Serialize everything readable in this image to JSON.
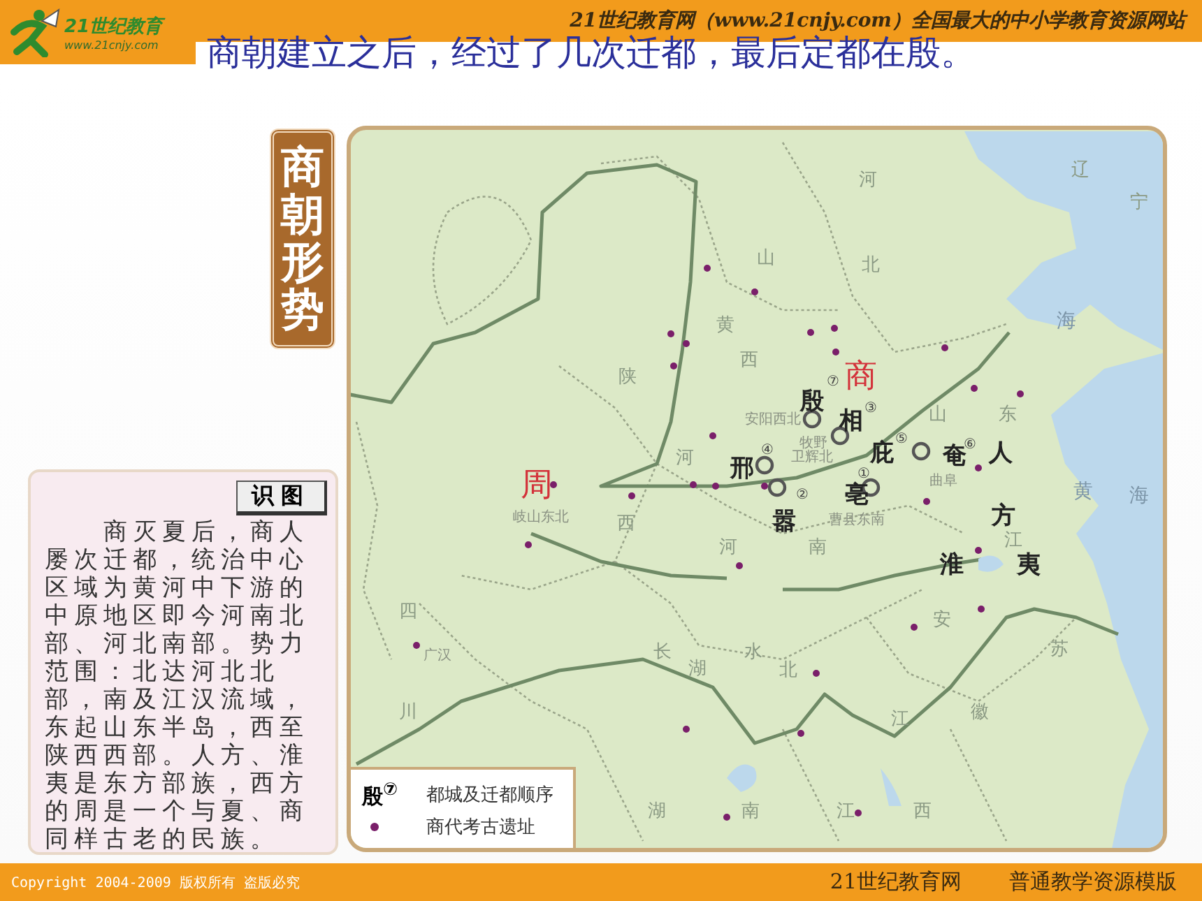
{
  "header": {
    "logo": {
      "name": "21世纪教育",
      "url": "www.21cnjy.com"
    },
    "tagline": "21世纪教育网（www.21cnjy.com）全国最大的中小学教育资源网站",
    "title": "商朝建立之后，经过了几次迁都，最后定都在殷。"
  },
  "map_title": "商朝形势",
  "reading_panel": {
    "tag": "识图",
    "text": "商灭夏后，商人屡次迁都，统治中心区域为黄河中下游的中原地区即今河南北部、河北南部。势力范围：北达河北北部，南及江汉流域，东起山东半岛，西至陕西西部。人方、淮夷是东方部族，西方的周是一个与夏、商同样古老的民族。"
  },
  "map": {
    "labels": [
      {
        "text": "辽",
        "kind": "province"
      },
      {
        "text": "宁",
        "kind": "province"
      },
      {
        "text": "河",
        "kind": "province"
      },
      {
        "text": "北",
        "kind": "province"
      },
      {
        "text": "山",
        "kind": "province"
      },
      {
        "text": "黄",
        "kind": "province"
      },
      {
        "text": "西",
        "kind": "province"
      },
      {
        "text": "陕",
        "kind": "province"
      },
      {
        "text": "海",
        "kind": "sea"
      },
      {
        "text": "⑦",
        "kind": "order"
      },
      {
        "text": "商",
        "kind": "dynasty"
      },
      {
        "text": "殷",
        "kind": "city"
      },
      {
        "text": "安阳西北",
        "kind": "place"
      },
      {
        "text": "相",
        "kind": "city"
      },
      {
        "text": "③",
        "kind": "order"
      },
      {
        "text": "牧野",
        "kind": "place"
      },
      {
        "text": "卫辉北",
        "kind": "place"
      },
      {
        "text": "⑤",
        "kind": "order"
      },
      {
        "text": "庇",
        "kind": "city"
      },
      {
        "text": "⑥",
        "kind": "order"
      },
      {
        "text": "奄",
        "kind": "city"
      },
      {
        "text": "曲阜",
        "kind": "place"
      },
      {
        "text": "人",
        "kind": "city"
      },
      {
        "text": "山",
        "kind": "province"
      },
      {
        "text": "东",
        "kind": "province"
      },
      {
        "text": "④",
        "kind": "order"
      },
      {
        "text": "邢",
        "kind": "city"
      },
      {
        "text": "河",
        "kind": "province"
      },
      {
        "text": "周",
        "kind": "dynasty"
      },
      {
        "text": "岐山东北",
        "kind": "place"
      },
      {
        "text": "西",
        "kind": "province"
      },
      {
        "text": "①",
        "kind": "order"
      },
      {
        "text": "②",
        "kind": "order"
      },
      {
        "text": "亳",
        "kind": "city"
      },
      {
        "text": "嚣",
        "kind": "city"
      },
      {
        "text": "曹县东南",
        "kind": "place"
      },
      {
        "text": "方",
        "kind": "city"
      },
      {
        "text": "江",
        "kind": "province"
      },
      {
        "text": "黄",
        "kind": "sea"
      },
      {
        "text": "海",
        "kind": "sea"
      },
      {
        "text": "河",
        "kind": "province"
      },
      {
        "text": "南",
        "kind": "province"
      },
      {
        "text": "淮",
        "kind": "city"
      },
      {
        "text": "夷",
        "kind": "city"
      },
      {
        "text": "四",
        "kind": "province"
      },
      {
        "text": "广汉",
        "kind": "place"
      },
      {
        "text": "川",
        "kind": "province"
      },
      {
        "text": "长",
        "kind": "province"
      },
      {
        "text": "湖",
        "kind": "province"
      },
      {
        "text": "水",
        "kind": "province"
      },
      {
        "text": "北",
        "kind": "province"
      },
      {
        "text": "安",
        "kind": "province"
      },
      {
        "text": "苏",
        "kind": "province"
      },
      {
        "text": "江",
        "kind": "province"
      },
      {
        "text": "徽",
        "kind": "province"
      },
      {
        "text": "湖",
        "kind": "province"
      },
      {
        "text": "南",
        "kind": "province"
      },
      {
        "text": "江",
        "kind": "province"
      },
      {
        "text": "西",
        "kind": "province"
      }
    ],
    "legend": [
      {
        "kind": "capital",
        "symbol": "殷$^{⑦}$",
        "label": "都城及迁都顺序"
      },
      {
        "kind": "site",
        "label": "商代考古遗址"
      }
    ]
  },
  "footer": {
    "copyright": "Copyright 2004-2009 版权所有 盗版必究",
    "site": "21世纪教育网",
    "template": "普通教学资源模版"
  }
}
